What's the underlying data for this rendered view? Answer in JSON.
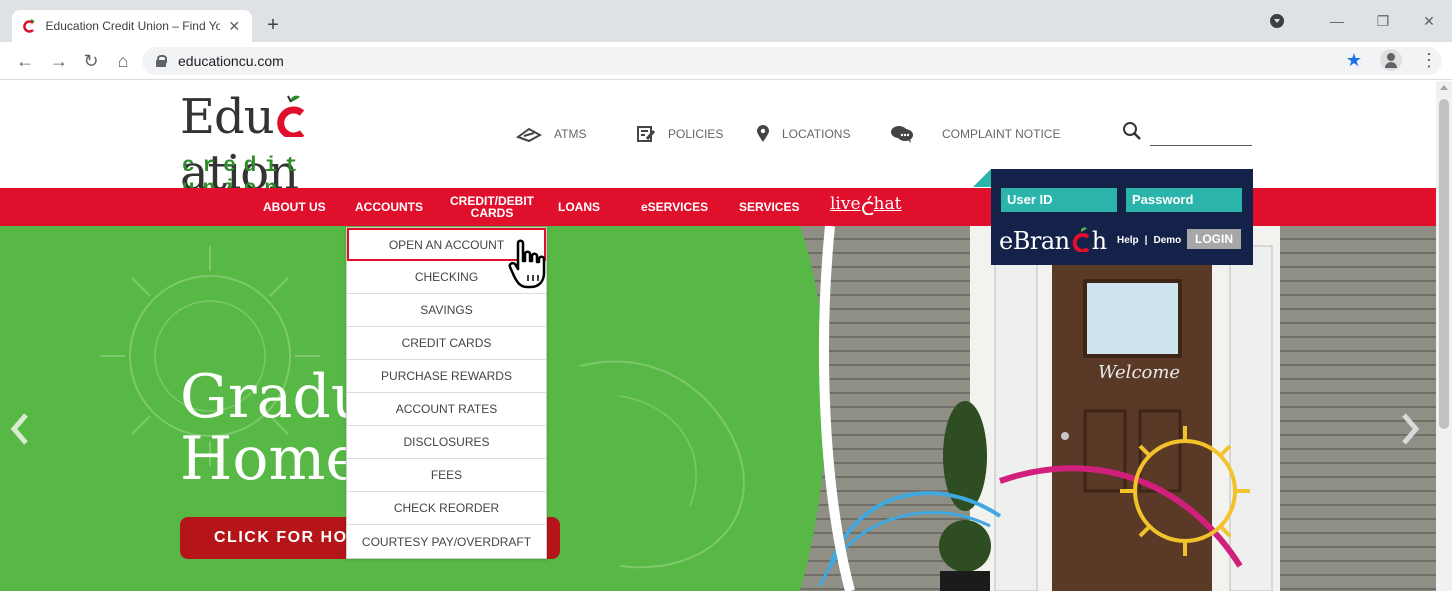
{
  "browser": {
    "tab_title": "Education Credit Union – Find Yo",
    "url": "educationcu.com"
  },
  "header": {
    "logo_word_left": "Edu",
    "logo_word_right": "ation",
    "logo_sub": "credit union",
    "utility": [
      {
        "label": "ATMS",
        "icon": "eye-icon"
      },
      {
        "label": "POLICIES",
        "icon": "edit-icon"
      },
      {
        "label": "LOCATIONS",
        "icon": "map-pin-icon"
      },
      {
        "label": "COMPLAINT NOTICE",
        "icon": "chat-bubbles-icon"
      }
    ]
  },
  "nav": {
    "about": "ABOUT US",
    "accounts": "ACCOUNTS",
    "cards_line1": "CREDIT/DEBIT",
    "cards_line2": "CARDS",
    "loans": "LOANS",
    "eservices": "eSERVICES",
    "services": "SERVICES",
    "livechat_left": "live",
    "livechat_right": "hat"
  },
  "dropdown": {
    "items": [
      "OPEN AN ACCOUNT",
      "CHECKING",
      "SAVINGS",
      "CREDIT CARDS",
      "PURCHASE REWARDS",
      "ACCOUNT RATES",
      "DISCLOSURES",
      "FEES",
      "CHECK REORDER",
      "COURTESY PAY/OVERDRAFT"
    ],
    "active_index": 0
  },
  "login": {
    "user_placeholder": "User ID",
    "password_placeholder": "Password",
    "brand_left": "eBran",
    "brand_right": "h",
    "help": "Help",
    "separator": "|",
    "demo": "Demo",
    "button": "LOGIN"
  },
  "hero": {
    "title_line1": "Gradu",
    "title_line2": "Home",
    "cta": "CLICK FOR HOME",
    "welcome_sign": "Welcome"
  },
  "colors": {
    "brand_red": "#e0102d",
    "hero_green": "#57b845",
    "login_navy": "#14224a",
    "login_teal": "#2bb4ac",
    "logo_green": "#2e8a2a"
  }
}
